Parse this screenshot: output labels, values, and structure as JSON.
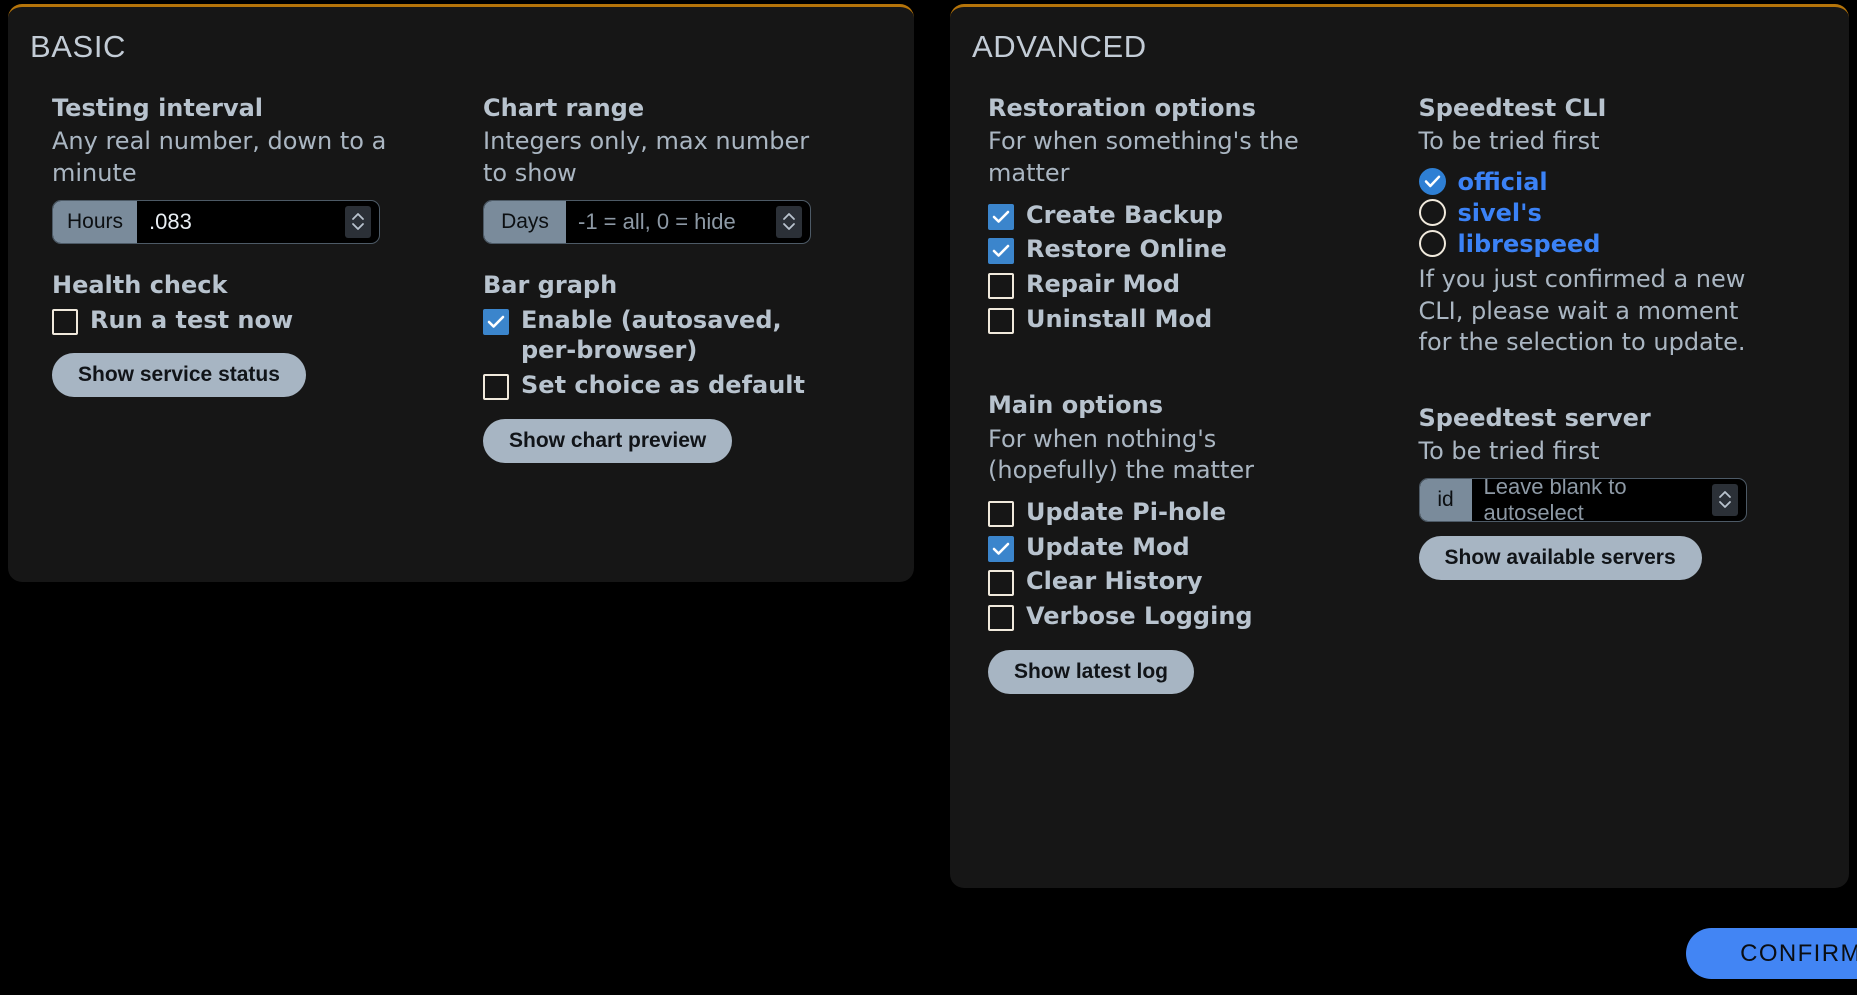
{
  "colors": {
    "page_bg": "#000000",
    "panel_bg": "#161616",
    "panel_top_border": "#b5740a",
    "accent_blue": "#3b82f6",
    "checkbox_checked": "#3b85cc",
    "button_bg": "#a7b5c3",
    "confirm_bg": "#4285f4",
    "text_primary": "#b8c3ce",
    "input_prefix_bg": "#7a8b9b"
  },
  "basic": {
    "title": "BASIC",
    "testing_interval": {
      "heading": "Testing interval",
      "subtext": "Any real number, down to a minute",
      "input": {
        "prefix": "Hours",
        "value": ".083",
        "placeholder": ""
      }
    },
    "chart_range": {
      "heading": "Chart range",
      "subtext": "Integers only, max number to show",
      "input": {
        "prefix": "Days",
        "value": "",
        "placeholder": "-1 = all, 0 = hide"
      }
    },
    "health_check": {
      "heading": "Health check",
      "checkbox": {
        "label": "Run a test now",
        "checked": false
      },
      "button": "Show service status"
    },
    "bar_graph": {
      "heading": "Bar graph",
      "checkboxes": [
        {
          "label": "Enable (autosaved, per-browser)",
          "checked": true
        },
        {
          "label": "Set choice as default",
          "checked": false
        }
      ],
      "button": "Show chart preview"
    }
  },
  "advanced": {
    "title": "ADVANCED",
    "restoration_options": {
      "heading": "Restoration options",
      "subtext": "For when something's the matter",
      "checkboxes": [
        {
          "label": "Create Backup",
          "checked": true
        },
        {
          "label": "Restore Online",
          "checked": true
        },
        {
          "label": "Repair Mod",
          "checked": false
        },
        {
          "label": "Uninstall Mod",
          "checked": false
        }
      ]
    },
    "main_options": {
      "heading": "Main options",
      "subtext": "For when nothing's (hopefully) the matter",
      "checkboxes": [
        {
          "label": "Update Pi-hole",
          "checked": false
        },
        {
          "label": "Update Mod",
          "checked": true
        },
        {
          "label": "Clear History",
          "checked": false
        },
        {
          "label": "Verbose Logging",
          "checked": false
        }
      ],
      "button": "Show latest log"
    },
    "speedtest_cli": {
      "heading": "Speedtest CLI",
      "subtext": "To be tried first",
      "radios": [
        {
          "label": "official",
          "selected": true
        },
        {
          "label": "sivel's",
          "selected": false
        },
        {
          "label": "librespeed",
          "selected": false
        }
      ],
      "note": "If you just confirmed a new CLI, please wait a moment for the selection to update."
    },
    "speedtest_server": {
      "heading": "Speedtest server",
      "subtext": "To be tried first",
      "input": {
        "prefix": "id",
        "value": "",
        "placeholder": "Leave blank to autoselect"
      },
      "button": "Show available servers"
    }
  },
  "footer": {
    "confirm_label": "CONFIRM"
  }
}
